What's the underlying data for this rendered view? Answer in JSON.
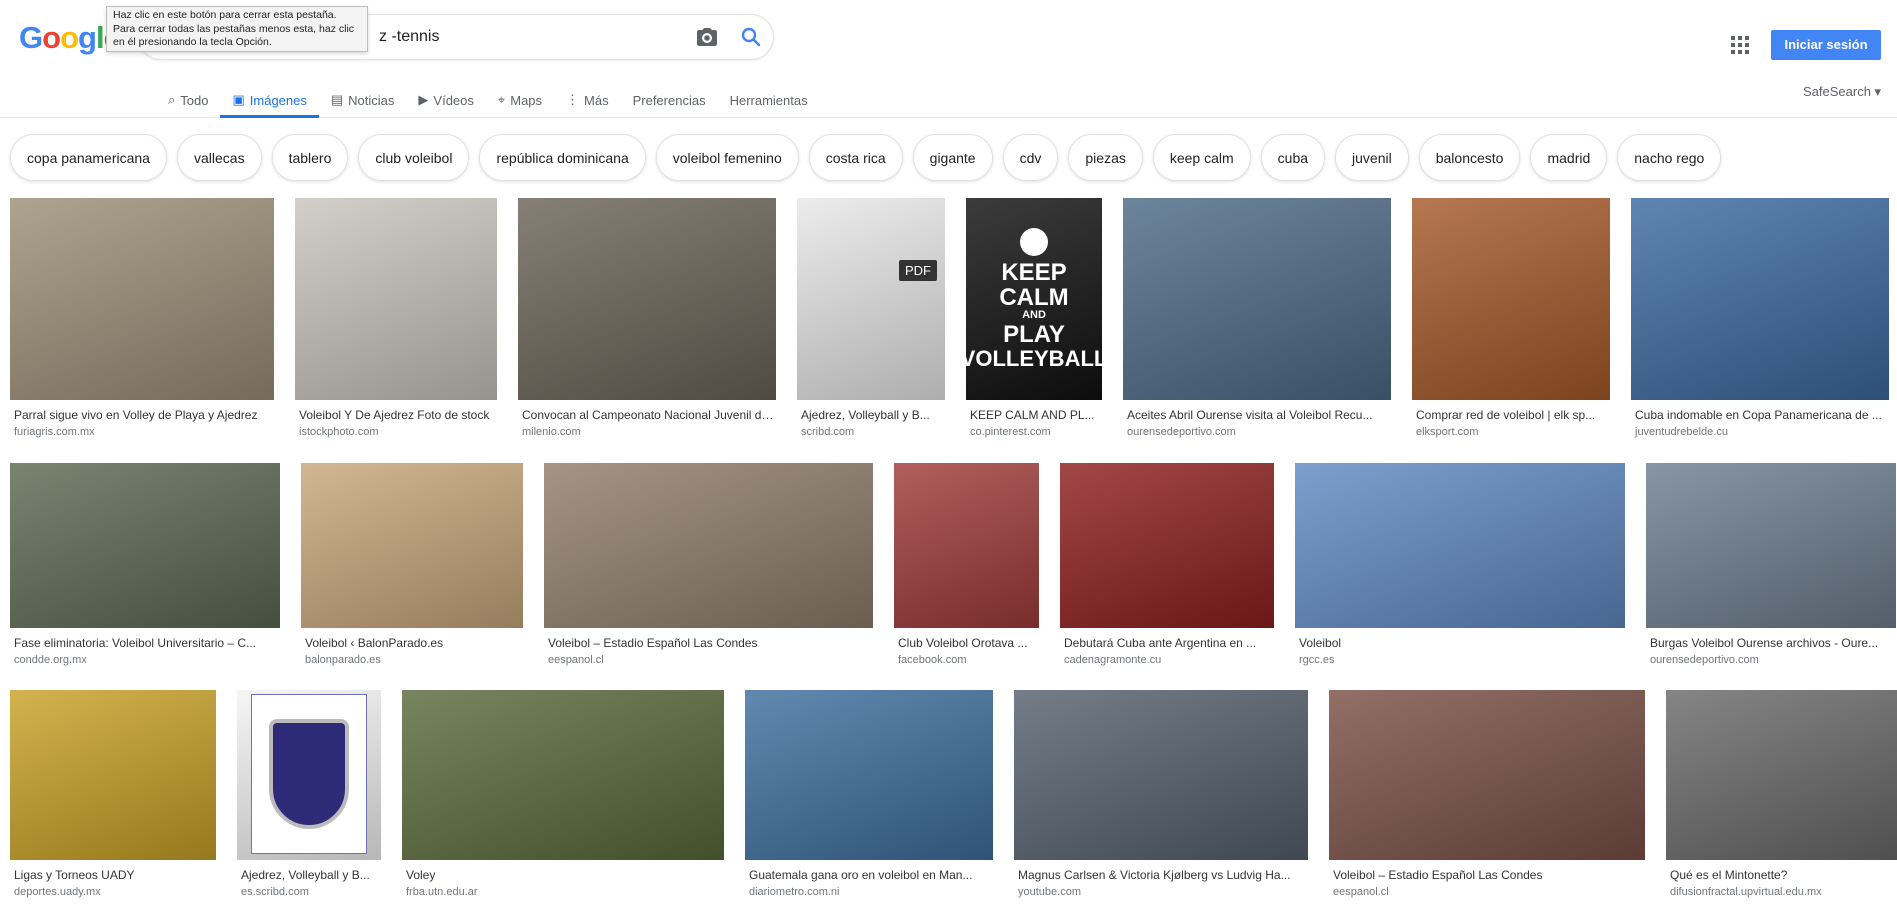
{
  "brand": {
    "logo_text": "Google",
    "colors": [
      "#4285f4",
      "#ea4335",
      "#fbbc05",
      "#4285f4",
      "#34a853",
      "#ea4335"
    ]
  },
  "search": {
    "query_text": "z -tennis",
    "camera_icon": "camera-icon",
    "search_icon": "search-icon"
  },
  "tooltip": {
    "text": "Haz clic en este botón para cerrar esta pestaña. Para cerrar todas las pestañas menos esta, haz clic en él presionando la tecla Opción."
  },
  "header": {
    "signin_label": "Iniciar sesión",
    "apps_icon": "apps-grid-icon"
  },
  "tabs": [
    {
      "label": "Todo",
      "icon": "search-icon",
      "active": false
    },
    {
      "label": "Imágenes",
      "icon": "image-icon",
      "active": true
    },
    {
      "label": "Noticias",
      "icon": "news-icon",
      "active": false
    },
    {
      "label": "Vídeos",
      "icon": "video-icon",
      "active": false
    },
    {
      "label": "Maps",
      "icon": "map-icon",
      "active": false
    },
    {
      "label": "Más",
      "icon": "more-vert-icon",
      "active": false
    },
    {
      "label": "Preferencias",
      "icon": "",
      "active": false
    },
    {
      "label": "Herramientas",
      "icon": "",
      "active": false
    }
  ],
  "safesearch": {
    "label": "SafeSearch ▾"
  },
  "chips": [
    "copa panamericana",
    "vallecas",
    "tablero",
    "club voleibol",
    "república dominicana",
    "voleibol femenino",
    "costa rica",
    "gigante",
    "cdv",
    "piezas",
    "keep calm",
    "cuba",
    "juvenil",
    "baloncesto",
    "madrid",
    "nacho rego"
  ],
  "results": [
    [
      {
        "title": "Parral sigue vivo en Volley de Playa y Ajedrez",
        "source": "furiagris.com.mx",
        "bg": "#9c8f78"
      },
      {
        "title": "Voleibol Y De Ajedrez Foto de stock",
        "source": "istockphoto.com",
        "bg": "#c9c4bd"
      },
      {
        "title": "Convocan al Campeonato Nacional Juvenil de ...",
        "source": "milenio.com",
        "bg": "#6b6458"
      },
      {
        "title": "Ajedrez, Volleyball y B...",
        "source": "scribd.com",
        "bg": "#e8e8e8",
        "badge": "PDF"
      },
      {
        "title": "KEEP CALM AND PL...",
        "source": "co.pinterest.com",
        "bg": "#111111",
        "keepcalm": [
          "KEEP",
          "CALM",
          "AND",
          "PLAY",
          "VOLLEYBALL"
        ]
      },
      {
        "title": "Aceites Abril Ourense visita al Voleibol Recu...",
        "source": "ourensedeportivo.com",
        "bg": "#4d6a86"
      },
      {
        "title": "Comprar red de voleibol | elk sp...",
        "source": "elksport.com",
        "bg": "#a55a2a"
      },
      {
        "title": "Cuba indomable en Copa Panamericana de ...",
        "source": "juventudrebelde.cu",
        "bg": "#3c6aa0"
      }
    ],
    [
      {
        "title": "Fase eliminatoria: Voleibol Universitario – C...",
        "source": "condde.org.mx",
        "bg": "#5b6a52"
      },
      {
        "title": "Voleibol ‹ BalonParado.es",
        "source": "balonparado.es",
        "bg": "#c9a77c"
      },
      {
        "title": "Voleibol – Estadio Español Las Condes",
        "source": "eespanol.cl",
        "bg": "#8f7d6c"
      },
      {
        "title": "Club Voleibol Orotava ...",
        "source": "facebook.com",
        "bg": "#a03b3b"
      },
      {
        "title": "Debutará Cuba ante Argentina en ...",
        "source": "cadenagramonte.cu",
        "bg": "#8e1f1f"
      },
      {
        "title": "Voleibol",
        "source": "rgcc.es",
        "bg": "#5f8ac2"
      },
      {
        "title": "Burgas Voleibol Ourense archivos - Oure...",
        "source": "ourensedeportivo.com",
        "bg": "#6e7f8f"
      }
    ],
    [
      {
        "title": "Ligas y Torneos UADY",
        "source": "deportes.uady.mx",
        "bg": "#c9a227"
      },
      {
        "title": "Ajedrez, Volleyball y B...",
        "source": "es.scribd.com",
        "bg": "#f4f4f4",
        "crest": true
      },
      {
        "title": "Voley",
        "source": "frba.utn.edu.ar",
        "bg": "#5a6a3a"
      },
      {
        "title": "Guatemala gana oro en voleibol en Man...",
        "source": "diariometro.com.ni",
        "bg": "#3f6f9f"
      },
      {
        "title": "Magnus Carlsen & Victoria Kjølberg vs Ludvig Ha...",
        "source": "youtube.com",
        "bg": "#55606e"
      },
      {
        "title": "Voleibol – Estadio Español Las Condes",
        "source": "eespanol.cl",
        "bg": "#7a5046"
      },
      {
        "title": "Qué es el Mintonette?",
        "source": "difusionfractal.upvirtual.edu.mx",
        "bg": "#6a6a6a"
      }
    ]
  ]
}
